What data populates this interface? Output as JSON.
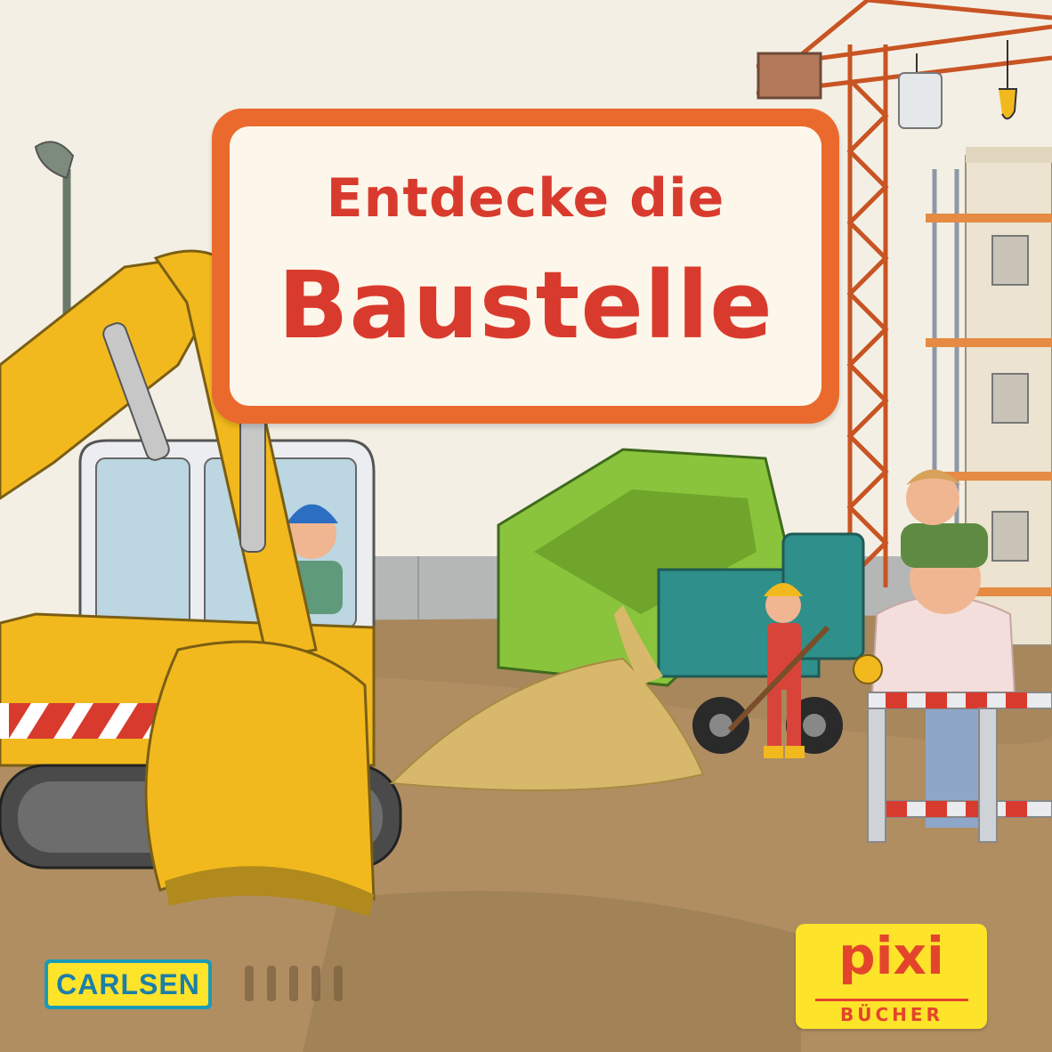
{
  "cover": {
    "title_line1": "Entdecke die",
    "title_line2": "Baustelle",
    "publisher_logo": "CARLSEN",
    "series_logo_main": "pixi",
    "series_logo_sub": "BÜCHER"
  },
  "colors": {
    "title_frame": "#ea6a2d",
    "title_text": "#d83b2d",
    "excavator": "#f2b91e",
    "dump_truck": "#8ac43c",
    "crane": "#d9662b",
    "ground": "#a8875c",
    "sky": "#f4efe4"
  }
}
